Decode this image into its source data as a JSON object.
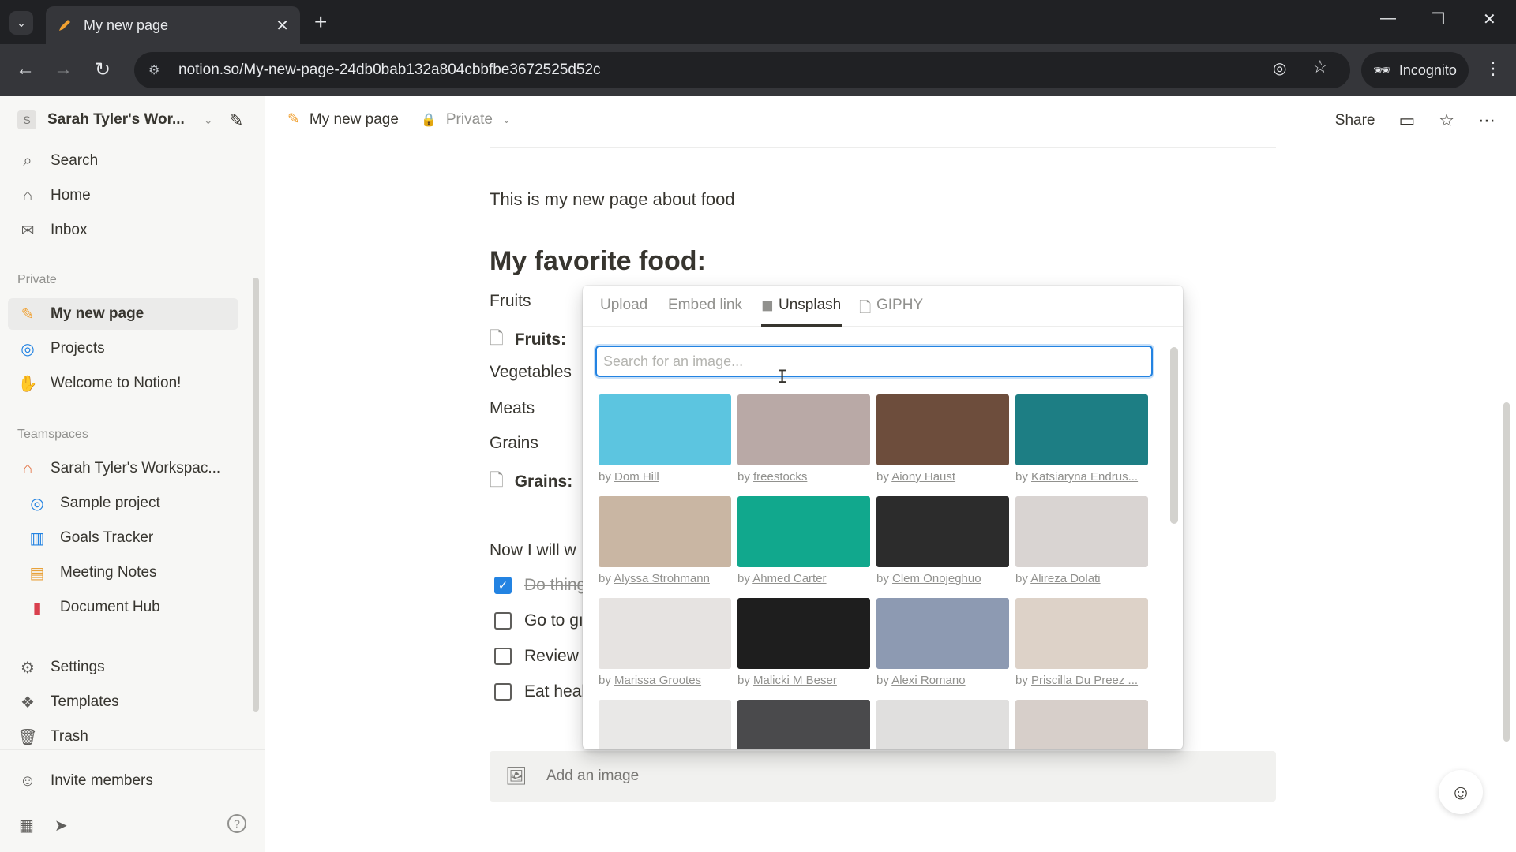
{
  "browser": {
    "tab_title": "My new page",
    "new_tab_symbol": "+",
    "url": "notion.so/My-new-page-24db0bab132a804cbbfbe3672525d52c",
    "incognito_label": "Incognito"
  },
  "sidebar": {
    "workspace_name": "Sarah Tyler's Wor...",
    "workspace_initial": "S",
    "top_items": [
      {
        "label": "Search",
        "icon": "search-icon"
      },
      {
        "label": "Home",
        "icon": "home-icon"
      },
      {
        "label": "Inbox",
        "icon": "inbox-icon"
      }
    ],
    "private_label": "Private",
    "private_items": [
      {
        "label": "My new page",
        "icon": "pencil-icon"
      },
      {
        "label": "Projects",
        "icon": "projects-icon"
      },
      {
        "label": "Welcome to Notion!",
        "icon": "wave-icon"
      }
    ],
    "teamspaces_label": "Teamspaces",
    "teamspace_name": "Sarah Tyler's Workspac...",
    "teamspace_items": [
      {
        "label": "Sample project",
        "icon": "target-icon"
      },
      {
        "label": "Goals Tracker",
        "icon": "chart-icon"
      },
      {
        "label": "Meeting Notes",
        "icon": "calendar-icon"
      },
      {
        "label": "Document Hub",
        "icon": "document-icon"
      }
    ],
    "bottom_items": [
      {
        "label": "Settings",
        "icon": "gear-icon"
      },
      {
        "label": "Templates",
        "icon": "templates-icon"
      },
      {
        "label": "Trash",
        "icon": "trash-icon"
      }
    ],
    "invite_label": "Invite members"
  },
  "header": {
    "page_title": "My new page",
    "privacy": "Private",
    "share_label": "Share"
  },
  "page": {
    "intro": "This is my new page about food",
    "heading": "My favorite food:",
    "rows": {
      "fruits": "Fruits",
      "fruits_link": "Fruits:",
      "vegetables": "Vegetables",
      "meats": "Meats",
      "grains": "Grains",
      "grains_link": "Grains:",
      "now": "Now I will w"
    },
    "todos": [
      {
        "text": "Do thing",
        "checked": true
      },
      {
        "text": "Go to gı",
        "checked": false
      },
      {
        "text": "Review",
        "checked": false
      },
      {
        "text": "Eat heal",
        "checked": false
      }
    ],
    "add_image_label": "Add an image"
  },
  "picker": {
    "tabs": [
      "Upload",
      "Embed link",
      "Unsplash",
      "GIPHY"
    ],
    "active_tab": "Unsplash",
    "search_placeholder": "Search for an image...",
    "by_prefix": "by",
    "images": [
      {
        "author": "Dom Hill",
        "color": "#5cc5e0"
      },
      {
        "author": "freestocks",
        "color": "#b9a9a6"
      },
      {
        "author": "Aiony Haust",
        "color": "#6d4d3c"
      },
      {
        "author": "Katsiaryna Endrus...",
        "color": "#1d7e84"
      },
      {
        "author": "Alyssa Strohmann",
        "color": "#c9b6a3"
      },
      {
        "author": "Ahmed Carter",
        "color": "#11a88d"
      },
      {
        "author": "Clem Onojeghuo",
        "color": "#2c2c2c"
      },
      {
        "author": "Alireza Dolati",
        "color": "#d9d4d2"
      },
      {
        "author": "Marissa Grootes",
        "color": "#e6e3e1"
      },
      {
        "author": "Malicki M Beser",
        "color": "#1e1e1e"
      },
      {
        "author": "Alexi Romano",
        "color": "#8d9ab2"
      },
      {
        "author": "Priscilla Du Preez ...",
        "color": "#ddd2c8"
      },
      {
        "author": "",
        "color": "#e9e8e7"
      },
      {
        "author": "",
        "color": "#4a4a4c"
      },
      {
        "author": "",
        "color": "#e0dfde"
      },
      {
        "author": "",
        "color": "#d7cfca"
      }
    ]
  },
  "colors": {
    "accent": "#2383e2",
    "sidebar_bg": "#f7f7f5",
    "chrome_dark": "#202124"
  }
}
